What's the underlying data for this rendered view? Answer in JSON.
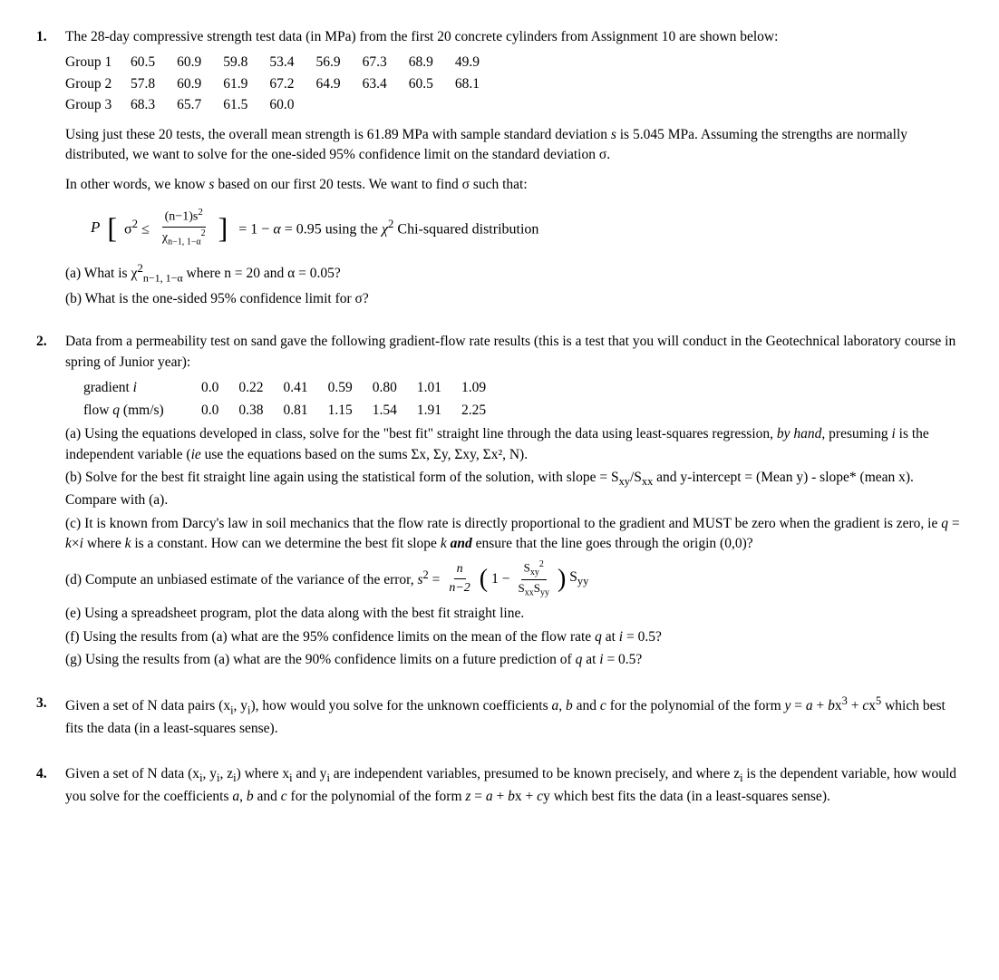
{
  "problems": [
    {
      "number": "1.",
      "intro": "The 28-day compressive strength test data (in MPa) from the first 20 concrete cylinders from Assignment 10 are shown below:",
      "groups": [
        {
          "label": "Group 1",
          "values": [
            "60.5",
            "60.9",
            "59.8",
            "53.4",
            "56.9",
            "67.3",
            "68.9",
            "49.9"
          ]
        },
        {
          "label": "Group 2",
          "values": [
            "57.8",
            "60.9",
            "61.9",
            "67.2",
            "64.9",
            "63.4",
            "60.5",
            "68.1"
          ]
        },
        {
          "label": "Group 3",
          "values": [
            "68.3",
            "65.7",
            "61.5",
            "60.0"
          ]
        }
      ],
      "paragraph": "Using just these 20 tests, the overall mean strength is 61.89 MPa with sample standard deviation s is 5.045 MPa.  Assuming the strengths are normally distributed, we want to solve for the one-sided 95% confidence limit on the standard deviation σ.",
      "in_other_words": "In other words, we know s based on our first 20 tests.   We want to find σ such that:",
      "parts_a": "(a)  What is χ²n−1, 1−α where n = 20 and α = 0.05?",
      "parts_b": "(b)  What is the one-sided 95% confidence limit for σ?"
    },
    {
      "number": "2.",
      "intro": "Data from a permeability test on sand gave the following gradient-flow rate results (this is a test that you will conduct in the Geotechnical laboratory course in spring of Junior year):",
      "gradient_row": {
        "label": "gradient i",
        "values": [
          "0.0",
          "0.22",
          "0.41",
          "0.59",
          "0.80",
          "1.01",
          "1.09"
        ]
      },
      "flow_row": {
        "label": "flow q (mm/s)",
        "values": [
          "0.0",
          "0.38",
          "0.81",
          "1.15",
          "1.54",
          "1.91",
          "2.25"
        ]
      },
      "part_a": "(a) Using the equations developed in class, solve for the \"best fit\" straight line through the data using least-squares regression, by hand, presuming i is the independent variable (ie use the equations based on the sums Σx, Σy, Σxy, Σx², N).",
      "part_b": "(b) Solve for the best fit straight line again using the statistical form of the solution, with slope = Sxy/Sxx and y-intercept = (Mean y) - slope* (mean x).  Compare with (a).",
      "part_c": "(c) It is known from Darcy's law in soil mechanics that the flow rate is directly proportional to the gradient and MUST be zero when the gradient is zero, ie q = k×i where k is a constant.  How can we determine the best fit slope k and ensure that the line goes through the origin (0,0)?",
      "part_d_prefix": "(d) Compute an unbiased estimate of the variance of the error, s² = ",
      "part_e": "(e) Using a spreadsheet program, plot the data along with the best fit straight line.",
      "part_f": "(f)  Using the results from (a) what are the 95% confidence limits on the mean of the flow rate q at i = 0.5?",
      "part_g": "(g) Using the results from (a) what are the 90% confidence limits on a future prediction of q at i = 0.5?"
    },
    {
      "number": "3.",
      "text": "Given a set of N data pairs (xᵢ, yᵢ), how would you solve for the unknown coefficients a, b and c for the polynomial of the form y = a + bx³ + cx⁵ which best fits the data (in a least-squares sense)."
    },
    {
      "number": "4.",
      "text": "Given a set of N data (xᵢ, yᵢ, zᵢ) where xᵢ and yᵢ are independent variables, presumed to be known precisely, and where zᵢ is the dependent variable, how would you solve for the coefficients a, b and c for the polynomial of the form z = a + bx + cy which best fits the data (in a least-squares sense)."
    }
  ]
}
